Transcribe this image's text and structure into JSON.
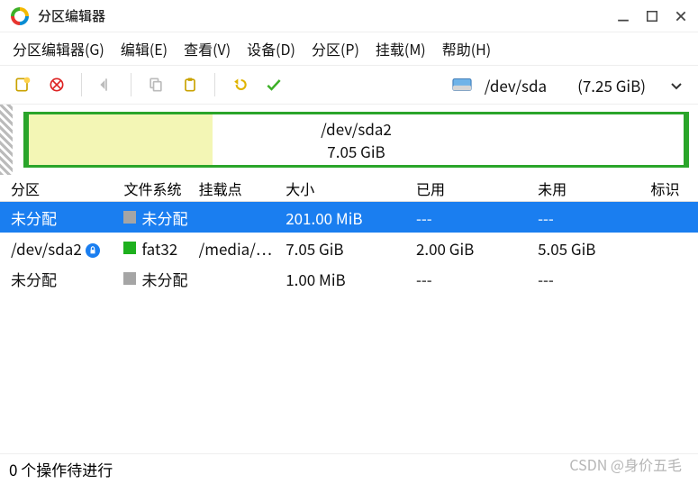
{
  "title": "分区编辑器",
  "menu": {
    "gparted": "分区编辑器(G)",
    "edit": "编辑(E)",
    "view": "查看(V)",
    "device": "设备(D)",
    "partition": "分区(P)",
    "mount": "挂载(M)",
    "help": "帮助(H)"
  },
  "device_selector": {
    "path": "/dev/sda",
    "size": "(7.25 GiB)"
  },
  "diskmap": {
    "path": "/dev/sda2",
    "size": "7.05 GiB"
  },
  "columns": {
    "partition": "分区",
    "fs": "文件系统",
    "mount": "挂载点",
    "size": "大小",
    "used": "已用",
    "free": "未用",
    "flags": "标识"
  },
  "rows": [
    {
      "partition": "未分配",
      "fs_label": "未分配",
      "fs_class": "fs-unalloc",
      "mount": "",
      "size": "201.00 MiB",
      "used": "---",
      "free": "---",
      "flags": "",
      "selected": true,
      "badge": false
    },
    {
      "partition": "/dev/sda2",
      "fs_label": "fat32",
      "fs_class": "fs-fat",
      "mount": "/media/…",
      "size": "7.05 GiB",
      "used": "2.00 GiB",
      "free": "5.05 GiB",
      "flags": "",
      "selected": false,
      "badge": true
    },
    {
      "partition": "未分配",
      "fs_label": "未分配",
      "fs_class": "fs-unalloc",
      "mount": "",
      "size": "1.00 MiB",
      "used": "---",
      "free": "---",
      "flags": "",
      "selected": false,
      "badge": false
    }
  ],
  "status": "0 个操作待进行",
  "watermark": "CSDN @身价五毛"
}
